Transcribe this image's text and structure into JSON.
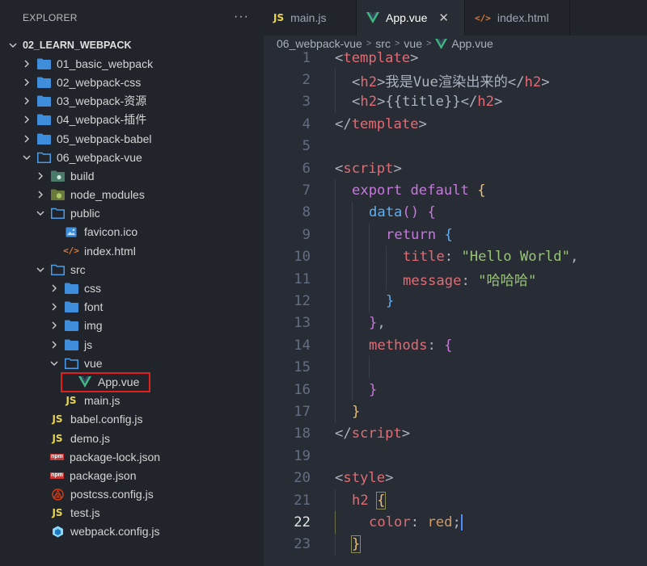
{
  "sidebar": {
    "title": "EXPLORER",
    "more": "···",
    "root_label": "02_LEARN_WEBPACK",
    "items": [
      {
        "label": "01_basic_webpack",
        "depth": 1,
        "type": "folder",
        "open": false
      },
      {
        "label": "02_webpack-css",
        "depth": 1,
        "type": "folder",
        "open": false
      },
      {
        "label": "03_webpack-资源",
        "depth": 1,
        "type": "folder",
        "open": false
      },
      {
        "label": "04_webpack-插件",
        "depth": 1,
        "type": "folder",
        "open": false
      },
      {
        "label": "05_webpack-babel",
        "depth": 1,
        "type": "folder",
        "open": false
      },
      {
        "label": "06_webpack-vue",
        "depth": 1,
        "type": "folder",
        "open": true
      },
      {
        "label": "build",
        "depth": 2,
        "type": "folder-special",
        "open": false
      },
      {
        "label": "node_modules",
        "depth": 2,
        "type": "folder-node",
        "open": false
      },
      {
        "label": "public",
        "depth": 2,
        "type": "folder",
        "open": true
      },
      {
        "label": "favicon.ico",
        "depth": 3,
        "type": "image"
      },
      {
        "label": "index.html",
        "depth": 3,
        "type": "html"
      },
      {
        "label": "src",
        "depth": 2,
        "type": "folder",
        "open": true
      },
      {
        "label": "css",
        "depth": 3,
        "type": "folder",
        "open": false
      },
      {
        "label": "font",
        "depth": 3,
        "type": "folder",
        "open": false
      },
      {
        "label": "img",
        "depth": 3,
        "type": "folder",
        "open": false
      },
      {
        "label": "js",
        "depth": 3,
        "type": "folder",
        "open": false
      },
      {
        "label": "vue",
        "depth": 3,
        "type": "folder",
        "open": true
      },
      {
        "label": "App.vue",
        "depth": 4,
        "type": "vue",
        "selected": true
      },
      {
        "label": "main.js",
        "depth": 3,
        "type": "js"
      },
      {
        "label": "babel.config.js",
        "depth": 2,
        "type": "js"
      },
      {
        "label": "demo.js",
        "depth": 2,
        "type": "js"
      },
      {
        "label": "package-lock.json",
        "depth": 2,
        "type": "npm"
      },
      {
        "label": "package.json",
        "depth": 2,
        "type": "npm"
      },
      {
        "label": "postcss.config.js",
        "depth": 2,
        "type": "postcss"
      },
      {
        "label": "test.js",
        "depth": 2,
        "type": "js"
      },
      {
        "label": "webpack.config.js",
        "depth": 2,
        "type": "webpack"
      }
    ]
  },
  "tabs": [
    {
      "label": "main.js",
      "icon": "js",
      "active": false
    },
    {
      "label": "App.vue",
      "icon": "vue",
      "active": true,
      "close": "✕"
    },
    {
      "label": "index.html",
      "icon": "html",
      "active": false
    }
  ],
  "breadcrumb": [
    "06_webpack-vue",
    "src",
    "vue",
    "App.vue"
  ],
  "code": {
    "current_line": 22,
    "lines": [
      {
        "n": "1"
      },
      {
        "n": "2"
      },
      {
        "n": "3"
      },
      {
        "n": "4"
      },
      {
        "n": "5"
      },
      {
        "n": "6"
      },
      {
        "n": "7"
      },
      {
        "n": "8"
      },
      {
        "n": "9"
      },
      {
        "n": "10"
      },
      {
        "n": "11"
      },
      {
        "n": "12"
      },
      {
        "n": "13"
      },
      {
        "n": "14"
      },
      {
        "n": "15"
      },
      {
        "n": "16"
      },
      {
        "n": "17"
      },
      {
        "n": "18"
      },
      {
        "n": "19"
      },
      {
        "n": "20"
      },
      {
        "n": "21"
      },
      {
        "n": "22"
      },
      {
        "n": "23"
      }
    ],
    "text": {
      "l1_tag": "template",
      "l2_text": "我是Vue渲染出来的",
      "l2_tag": "h2",
      "l3_expr": "{{title}}",
      "l3_tag": "h2",
      "l4_tag": "template",
      "l6_tag": "script",
      "l7_kw1": "export",
      "l7_kw2": "default",
      "l8_fn": "data",
      "l9_kw": "return",
      "l10_prop": "title",
      "l10_str": "\"Hello World\"",
      "l11_prop": "message",
      "l11_str": "\"哈哈哈\"",
      "l14_prop": "methods",
      "l18_tag": "script",
      "l20_tag": "style",
      "l21_sel": "h2",
      "l22_prop": "color",
      "l22_val": "red"
    }
  },
  "colors": {
    "sidebar_bg": "#21252b",
    "editor_bg": "#282c34",
    "folder_blue": "#3f8edc",
    "vue_green": "#41b883",
    "js_yellow": "#e8d44d",
    "selection_border": "#e02020"
  }
}
